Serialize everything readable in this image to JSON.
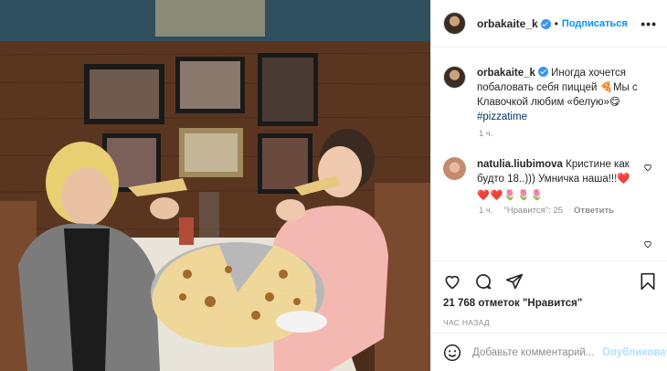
{
  "post": {
    "image_alt": "Photo of two people eating pizza in a booth",
    "header": {
      "username": "orbakaite_k",
      "verified": true,
      "dot": "•",
      "follow_label": "Подписаться",
      "more_icon": "more-horizontal-icon"
    },
    "caption": {
      "username": "orbakaite_k",
      "text": "Иногда хочется побаловать себя пиццей 🍕Мы с Клавочкой любим «белую»😋",
      "hashtag": "#pizzatime",
      "time": "1 ч."
    },
    "comment": {
      "username": "natulia.liubimova",
      "text": "Кристине как будто 18..))) Умничка наша!!!❤️",
      "emoji_line": "❤️❤️🌷🌷🌷",
      "time": "1 ч.",
      "likes": "\"Нравится\": 25",
      "reply_label": "Ответить"
    },
    "actions": {
      "likes_count": "21 768 отметок \"Нравится\"",
      "posted": "ЧАС НАЗАД"
    },
    "add_comment": {
      "placeholder": "Добавьте комментарий...",
      "publish_label": "Опубликовать"
    }
  }
}
